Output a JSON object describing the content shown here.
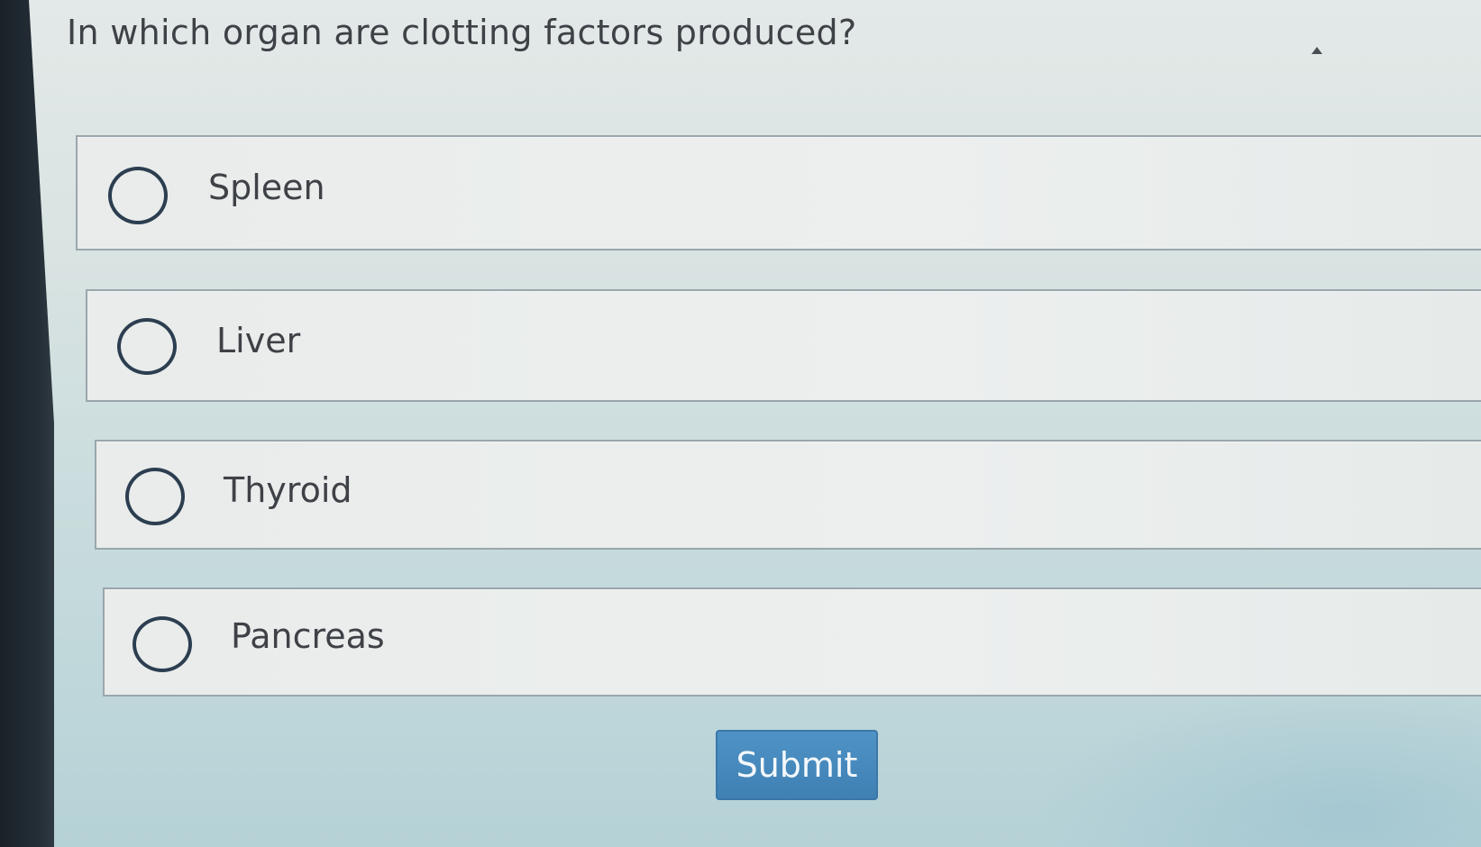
{
  "question": {
    "text": "In which organ are clotting factors produced?"
  },
  "options": [
    {
      "label": "Spleen",
      "selected": false
    },
    {
      "label": "Liver",
      "selected": false
    },
    {
      "label": "Thyroid",
      "selected": false
    },
    {
      "label": "Pancreas",
      "selected": false
    }
  ],
  "submit": {
    "label": "Submit"
  },
  "icons": {
    "collapse": "caret-up-icon",
    "radio": "radio-unchecked-icon"
  },
  "colors": {
    "accent": "#4488bf",
    "radio_border": "#2c3e50",
    "text": "#3e4247"
  }
}
